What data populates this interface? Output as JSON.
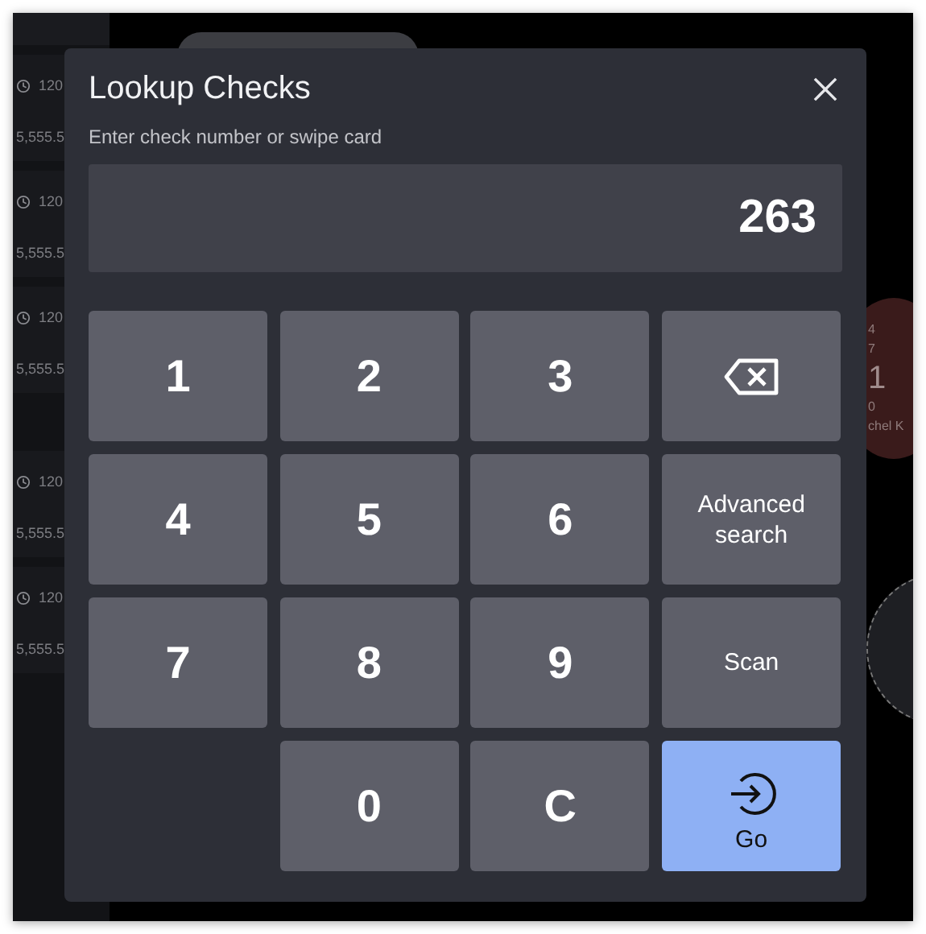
{
  "background": {
    "check_rows": [
      {
        "number": "120",
        "amount": "5,555.5"
      },
      {
        "number": "120",
        "amount": "5,555.5"
      },
      {
        "number": "120",
        "amount": "5,555.5"
      },
      {
        "number": "120",
        "amount": "5,555.5"
      },
      {
        "number": "120",
        "amount": "5,555.5"
      }
    ],
    "table_badge": {
      "lines": [
        "4",
        "7",
        "1",
        "0",
        "chel K"
      ]
    }
  },
  "dialog": {
    "title": "Lookup Checks",
    "subtitle": "Enter check number or swipe card",
    "value": "263",
    "keypad": [
      [
        {
          "kind": "digit",
          "label": "1"
        },
        {
          "kind": "digit",
          "label": "2"
        },
        {
          "kind": "digit",
          "label": "3"
        },
        {
          "kind": "backspace"
        }
      ],
      [
        {
          "kind": "digit",
          "label": "4"
        },
        {
          "kind": "digit",
          "label": "5"
        },
        {
          "kind": "digit",
          "label": "6"
        },
        {
          "kind": "text",
          "label": "Advanced search"
        }
      ],
      [
        {
          "kind": "digit",
          "label": "7"
        },
        {
          "kind": "digit",
          "label": "8"
        },
        {
          "kind": "digit",
          "label": "9"
        },
        {
          "kind": "text",
          "label": "Scan"
        }
      ],
      [
        {
          "kind": "digit",
          "label": "0"
        },
        {
          "kind": "digit",
          "label": "C"
        },
        {
          "kind": "go",
          "label": "Go"
        }
      ]
    ]
  }
}
